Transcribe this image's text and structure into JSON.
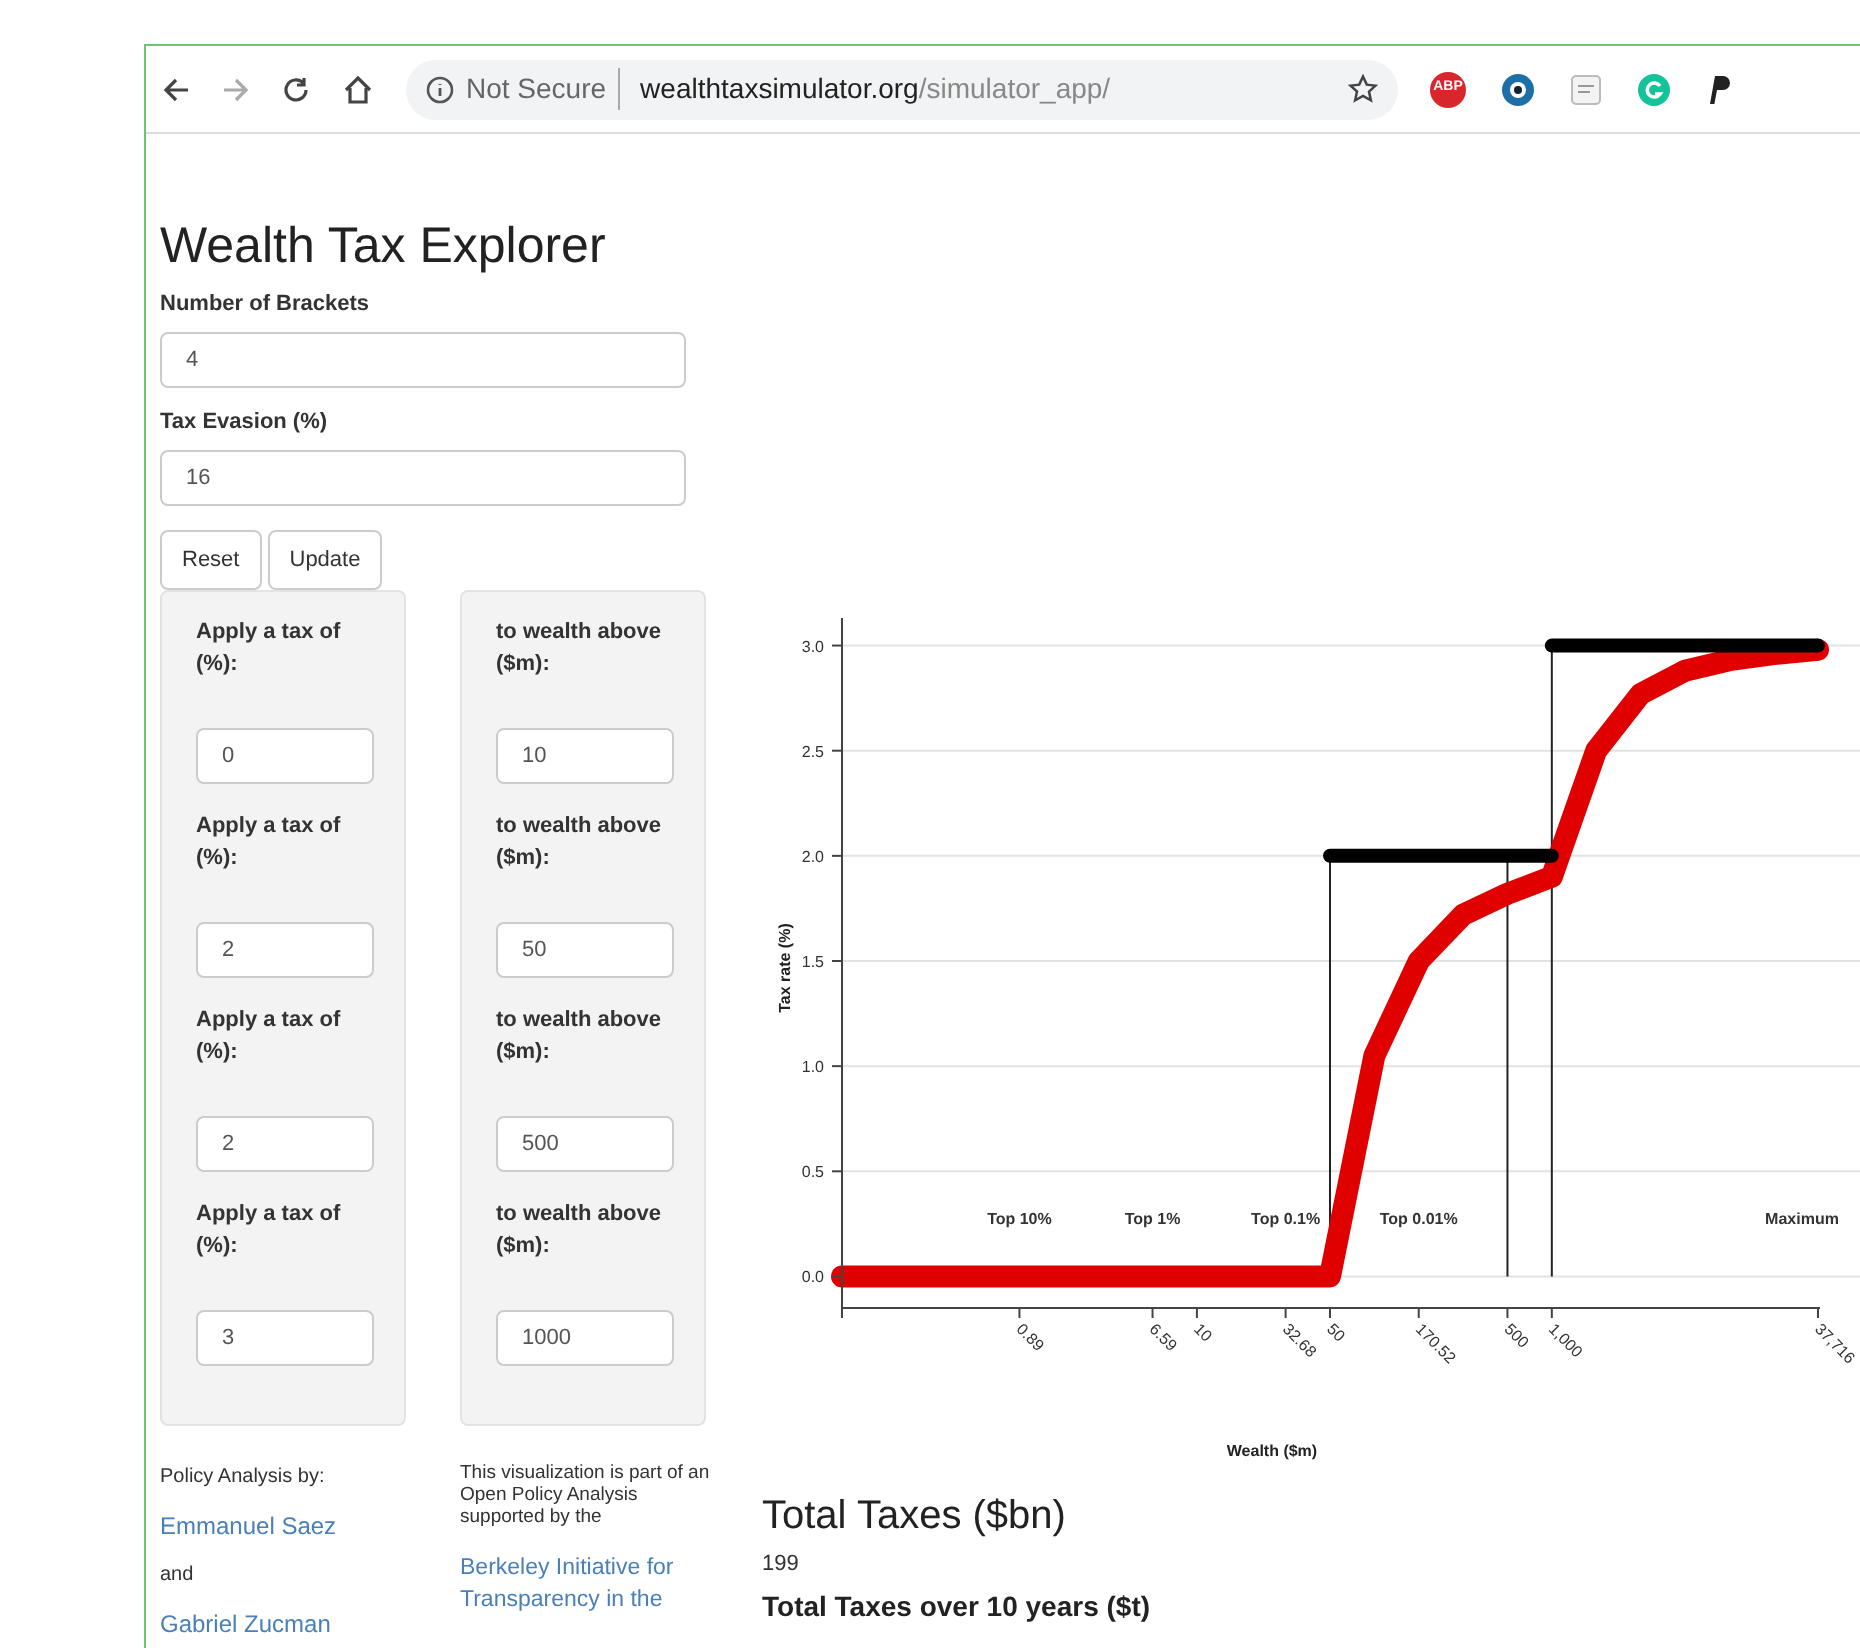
{
  "browser": {
    "security": "Not Secure",
    "url_host": "wealthtaxsimulator.org",
    "url_path": "/simulator_app/",
    "extensions": [
      {
        "kind": "abp",
        "label": "ABP"
      },
      {
        "kind": "eye"
      },
      {
        "kind": "tex"
      },
      {
        "kind": "grammar"
      },
      {
        "kind": "p"
      }
    ]
  },
  "page": {
    "title": "Wealth Tax Explorer",
    "fields": [
      {
        "label": "Number of Brackets",
        "value": "4"
      },
      {
        "label": "Tax Evasion (%)",
        "value": "16"
      }
    ],
    "buttons": [
      "Reset",
      "Update"
    ],
    "brackets": [
      {
        "rate_label": "Apply a tax of (%):",
        "rate": "0",
        "threshold_label": "to wealth above ($m):",
        "threshold": "10"
      },
      {
        "rate_label": "Apply a tax of (%):",
        "rate": "2",
        "threshold_label": "to wealth above ($m):",
        "threshold": "50"
      },
      {
        "rate_label": "Apply a tax of (%):",
        "rate": "2",
        "threshold_label": "to wealth above ($m):",
        "threshold": "500"
      },
      {
        "rate_label": "Apply a tax of (%):",
        "rate": "3",
        "threshold_label": "to wealth above ($m):",
        "threshold": "1000"
      }
    ],
    "credits": {
      "heading": "Policy Analysis by:",
      "authors": [
        "Emmanuel Saez",
        "Gabriel Zucman"
      ],
      "joiner": "and"
    },
    "support": {
      "text": "This visualization is part of an Open Policy Analysis supported by the",
      "link": "Berkeley Initiative for Transparency in the"
    },
    "results": [
      {
        "kind": "heading",
        "text": "Total Taxes ($bn)"
      },
      {
        "kind": "value",
        "text": "199"
      },
      {
        "kind": "subheading",
        "text": "Total Taxes over 10 years ($t)"
      }
    ],
    "chart_data": {
      "type": "line",
      "xlabel": "Wealth ($m)",
      "ylabel": "Tax rate (%)",
      "categories": [
        null,
        null,
        null,
        null,
        "0.89",
        null,
        null,
        "6.59",
        "10",
        null,
        "32.68",
        "50",
        null,
        "170.52",
        null,
        "500",
        "1,000",
        null,
        null,
        null,
        null,
        null,
        "37,716"
      ],
      "series": [
        {
          "color": "#e00000",
          "values": [
            0,
            0,
            0,
            0,
            0,
            0,
            0,
            0,
            0,
            0,
            0,
            0,
            1.05,
            1.5,
            1.72,
            1.82,
            1.9,
            2.5,
            2.77,
            2.88,
            2.93,
            2.96,
            2.98
          ]
        },
        {
          "color": "#000000",
          "values": [
            null,
            null,
            null,
            null,
            null,
            null,
            null,
            null,
            null,
            null,
            null,
            2,
            2,
            2,
            2,
            2,
            2,
            null,
            null,
            null,
            null,
            null,
            null
          ]
        },
        {
          "color": "#000000",
          "values": [
            null,
            null,
            null,
            null,
            null,
            null,
            null,
            null,
            null,
            null,
            null,
            null,
            null,
            null,
            null,
            null,
            3,
            3,
            3,
            3,
            3,
            3,
            3
          ]
        }
      ],
      "ylim": [
        -0.15,
        3.15
      ],
      "grid": true,
      "yticks": [
        {
          "value": 0,
          "label": "0.0"
        },
        {
          "value": 0.5,
          "label": "0.5"
        },
        {
          "value": 1,
          "label": "1.0"
        },
        {
          "value": 1.5,
          "label": "1.5"
        },
        {
          "value": 2,
          "label": "2.0"
        },
        {
          "value": 2.5,
          "label": "2.5"
        },
        {
          "value": 3,
          "label": "3.0"
        }
      ],
      "annotations": [
        "Top 10%",
        "Top 1%",
        "Top 0.1%",
        "Top 0.01%",
        "Maximum"
      ],
      "ref_lines": [
        {
          "axis": "x",
          "value": "50"
        },
        {
          "axis": "x",
          "value": "500"
        },
        {
          "axis": "x",
          "value": "1,000"
        }
      ]
    }
  }
}
